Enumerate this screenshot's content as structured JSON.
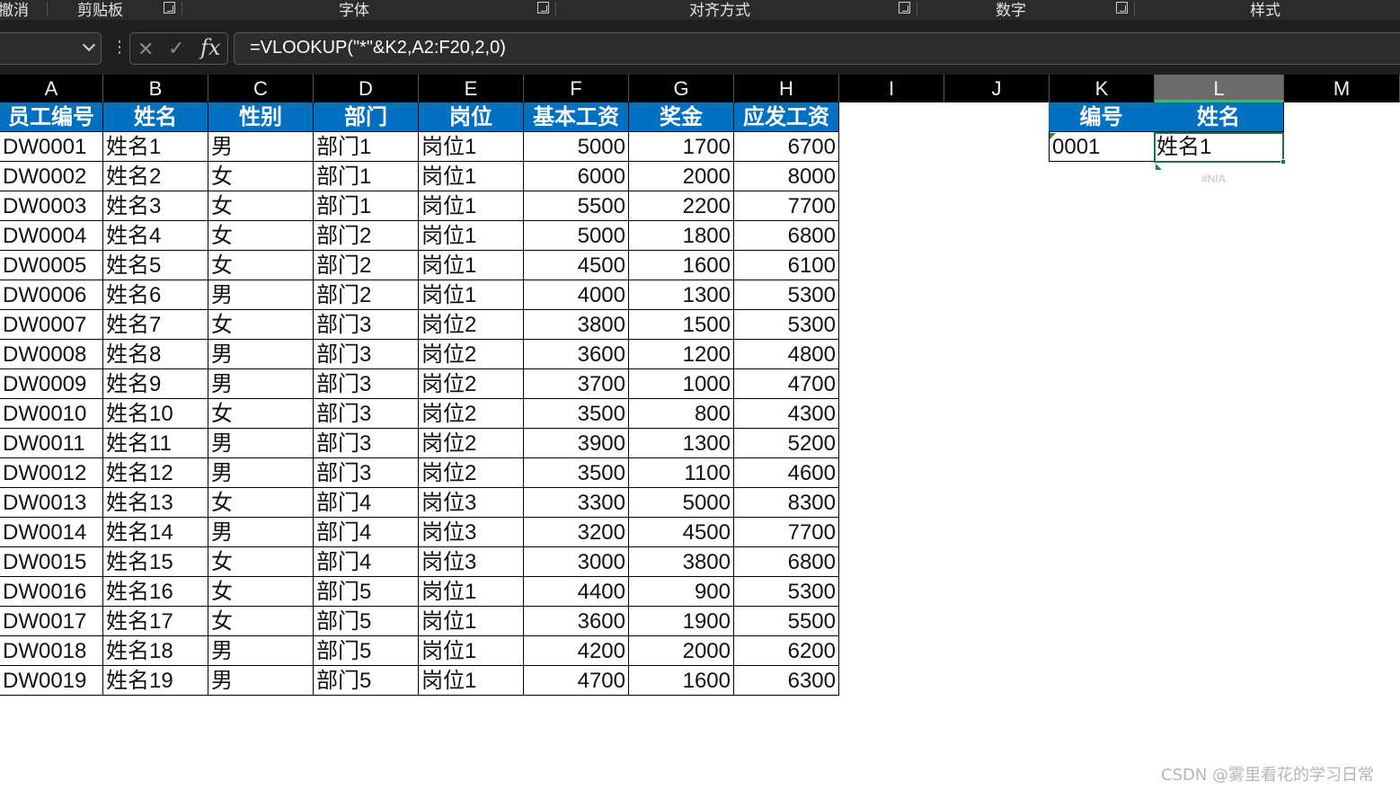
{
  "ribbon": {
    "groups": [
      {
        "label": "撤消"
      },
      {
        "label": "剪贴板"
      },
      {
        "label": "字体"
      },
      {
        "label": "对齐方式"
      },
      {
        "label": "数字"
      },
      {
        "label": "样式"
      }
    ]
  },
  "formula_bar": {
    "name_box": "",
    "cancel_icon": "close-icon",
    "enter_icon": "checkmark-icon",
    "function_label": "fx",
    "formula": "=VLOOKUP(\"*\"&K2,A2:F20,2,0)"
  },
  "columns": [
    "A",
    "B",
    "C",
    "D",
    "E",
    "F",
    "G",
    "H",
    "I",
    "J",
    "K",
    "L",
    "M"
  ],
  "selected_column": "L",
  "table": {
    "headers": [
      "员工编号",
      "姓名",
      "性别",
      "部门",
      "岗位",
      "基本工资",
      "奖金",
      "应发工资"
    ],
    "rows": [
      [
        "DW0001",
        "姓名1",
        "男",
        "部门1",
        "岗位1",
        "5000",
        "1700",
        "6700"
      ],
      [
        "DW0002",
        "姓名2",
        "女",
        "部门1",
        "岗位1",
        "6000",
        "2000",
        "8000"
      ],
      [
        "DW0003",
        "姓名3",
        "女",
        "部门1",
        "岗位1",
        "5500",
        "2200",
        "7700"
      ],
      [
        "DW0004",
        "姓名4",
        "女",
        "部门2",
        "岗位1",
        "5000",
        "1800",
        "6800"
      ],
      [
        "DW0005",
        "姓名5",
        "女",
        "部门2",
        "岗位1",
        "4500",
        "1600",
        "6100"
      ],
      [
        "DW0006",
        "姓名6",
        "男",
        "部门2",
        "岗位1",
        "4000",
        "1300",
        "5300"
      ],
      [
        "DW0007",
        "姓名7",
        "女",
        "部门3",
        "岗位2",
        "3800",
        "1500",
        "5300"
      ],
      [
        "DW0008",
        "姓名8",
        "男",
        "部门3",
        "岗位2",
        "3600",
        "1200",
        "4800"
      ],
      [
        "DW0009",
        "姓名9",
        "男",
        "部门3",
        "岗位2",
        "3700",
        "1000",
        "4700"
      ],
      [
        "DW0010",
        "姓名10",
        "女",
        "部门3",
        "岗位2",
        "3500",
        "800",
        "4300"
      ],
      [
        "DW0011",
        "姓名11",
        "男",
        "部门3",
        "岗位2",
        "3900",
        "1300",
        "5200"
      ],
      [
        "DW0012",
        "姓名12",
        "男",
        "部门3",
        "岗位2",
        "3500",
        "1100",
        "4600"
      ],
      [
        "DW0013",
        "姓名13",
        "女",
        "部门4",
        "岗位3",
        "3300",
        "5000",
        "8300"
      ],
      [
        "DW0014",
        "姓名14",
        "男",
        "部门4",
        "岗位3",
        "3200",
        "4500",
        "7700"
      ],
      [
        "DW0015",
        "姓名15",
        "女",
        "部门4",
        "岗位3",
        "3000",
        "3800",
        "6800"
      ],
      [
        "DW0016",
        "姓名16",
        "女",
        "部门5",
        "岗位1",
        "4400",
        "900",
        "5300"
      ],
      [
        "DW0017",
        "姓名17",
        "女",
        "部门5",
        "岗位1",
        "3600",
        "1900",
        "5500"
      ],
      [
        "DW0018",
        "姓名18",
        "男",
        "部门5",
        "岗位1",
        "4200",
        "2000",
        "6200"
      ],
      [
        "DW0019",
        "姓名19",
        "男",
        "部门5",
        "岗位1",
        "4700",
        "1600",
        "6300"
      ]
    ]
  },
  "lookup": {
    "headers": [
      "编号",
      "姓名"
    ],
    "row": [
      "0001",
      "姓名1"
    ],
    "spill_hint": "#N/A"
  },
  "colors": {
    "header_fill": "#0070c0",
    "header_text": "#ffffff",
    "selection": "#1e7145",
    "chrome_dark": "#1f1f1f"
  },
  "watermark": "CSDN @雾里看花的学习日常"
}
